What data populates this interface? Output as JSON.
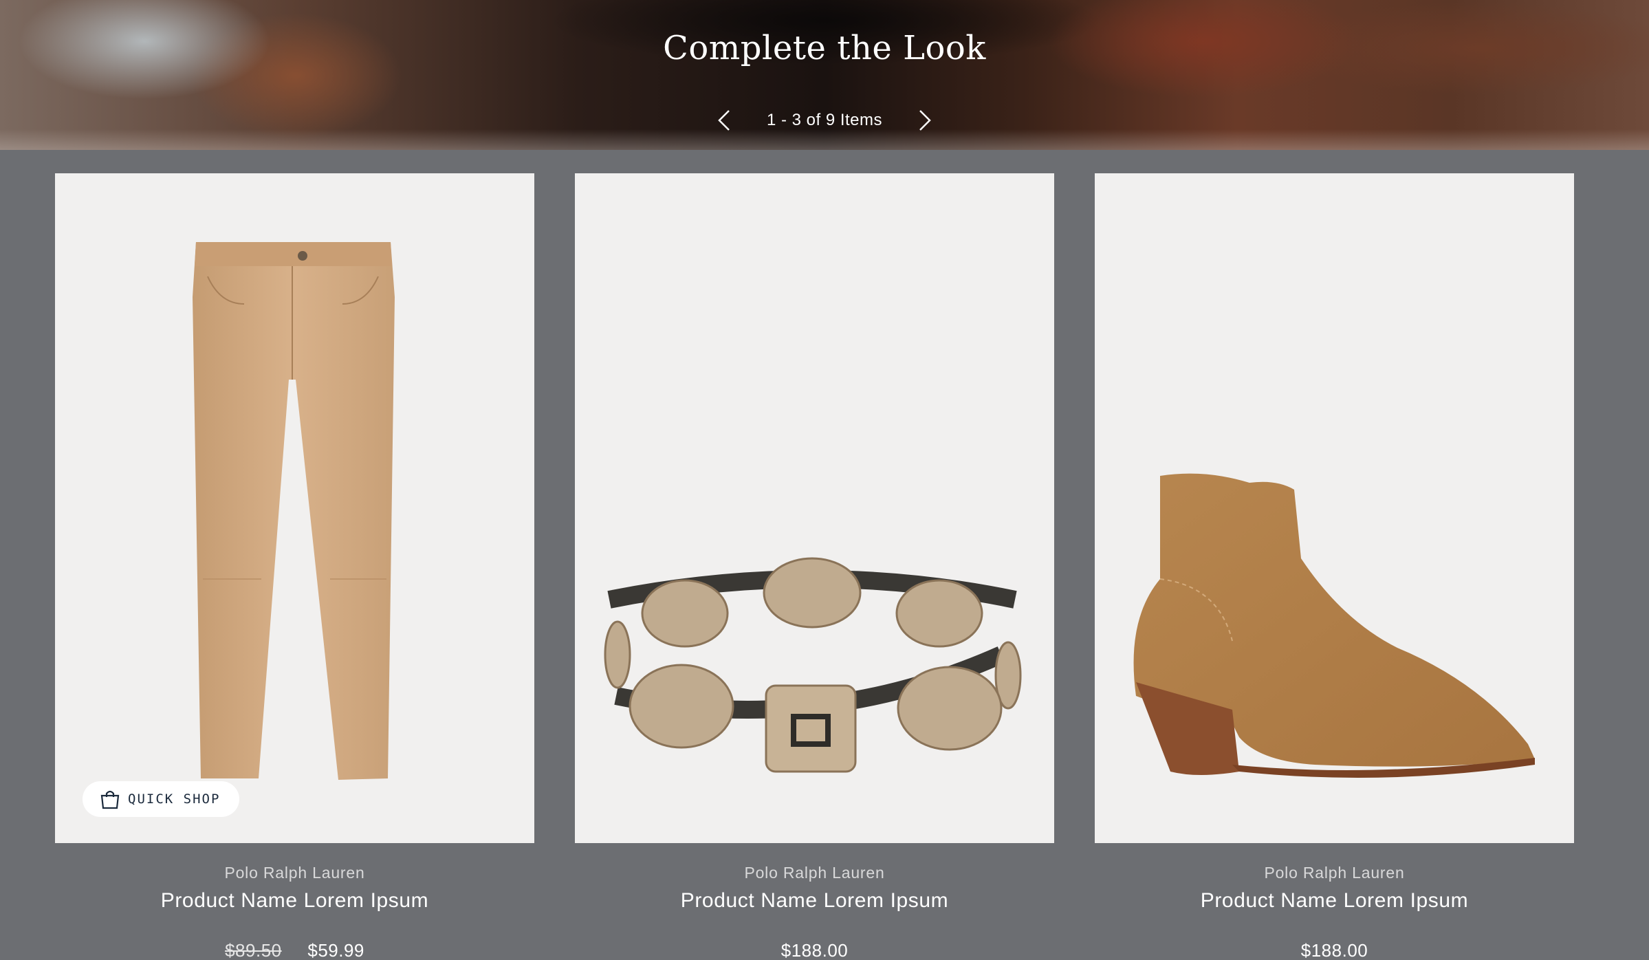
{
  "section": {
    "title": "Complete the Look",
    "pager_text": "1 - 3 of 9 Items",
    "prev_icon": "chevron-left-icon",
    "next_icon": "chevron-right-icon"
  },
  "products": [
    {
      "brand": "Polo Ralph Lauren",
      "name": "Product Name Lorem Ipsum",
      "original_price": "$89.50",
      "price": "$59.99",
      "image": "tan-leather-skinny-pants",
      "quick_shop_label": "QUICK SHOP"
    },
    {
      "brand": "Polo Ralph Lauren",
      "name": "Product Name Lorem Ipsum",
      "price": "$188.00",
      "image": "concho-leather-belt"
    },
    {
      "brand": "Polo Ralph Lauren",
      "name": "Product Name Lorem Ipsum",
      "price": "$188.00",
      "image": "suede-western-ankle-boot"
    }
  ],
  "colors": {
    "page_background": "#6c6e72",
    "card_background": "#f1f0ef",
    "quick_shop_text": "#1b2a3c"
  }
}
